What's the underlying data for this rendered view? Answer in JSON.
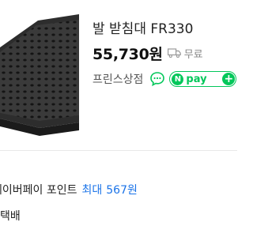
{
  "product": {
    "title": "발 받침대 FR330",
    "price": "55,730원",
    "shipping": "무료",
    "seller": "프린스상점"
  },
  "icons": {
    "truck": "truck-icon",
    "chat": "chat-bubble-icon",
    "npay": "npay-plus-badge"
  },
  "npay": {
    "n": "N",
    "label": "pay",
    "plus": "+"
  },
  "benefits": {
    "points_label": "네이버페이 포인트",
    "points_max": "최대",
    "points_value": "567원",
    "delivery": "택배"
  },
  "colors": {
    "accent_green": "#03c75a",
    "link_blue": "#1a73e8",
    "muted_gray": "#888888"
  }
}
